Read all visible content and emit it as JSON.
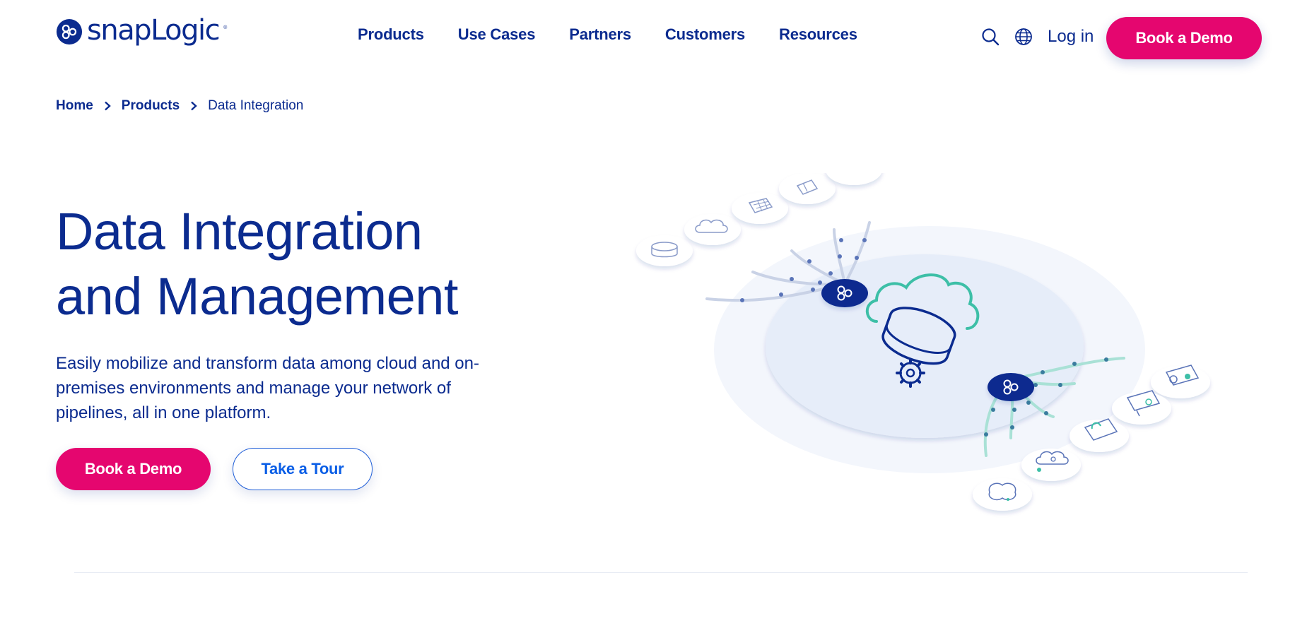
{
  "header": {
    "logo_text": "snapLogic",
    "logo_tm": "®",
    "nav": [
      "Products",
      "Use Cases",
      "Partners",
      "Customers",
      "Resources"
    ],
    "login_label": "Log in",
    "demo_label": "Book a Demo"
  },
  "breadcrumb": {
    "home": "Home",
    "products": "Products",
    "current": "Data Integration"
  },
  "hero": {
    "title_line1": "Data Integration",
    "title_line2": "and Management",
    "description": "Easily mobilize and transform data among cloud and on-premises environments and manage your network of pipelines, all in one platform.",
    "primary_cta": "Book a Demo",
    "secondary_cta": "Take a Tour"
  },
  "colors": {
    "brand_blue": "#0b2b8f",
    "brand_pink": "#e5066f",
    "link_blue": "#0a5ee6",
    "teal": "#3dbfa7"
  },
  "icons": [
    "logo-mark-icon",
    "search-icon",
    "globe-icon",
    "chevron-right-icon",
    "hub-node-icon",
    "database-icon",
    "cloud-icon",
    "gear-icon",
    "brain-icon",
    "dashboard-icon",
    "table-icon",
    "document-icon",
    "browser-gear-icon"
  ]
}
